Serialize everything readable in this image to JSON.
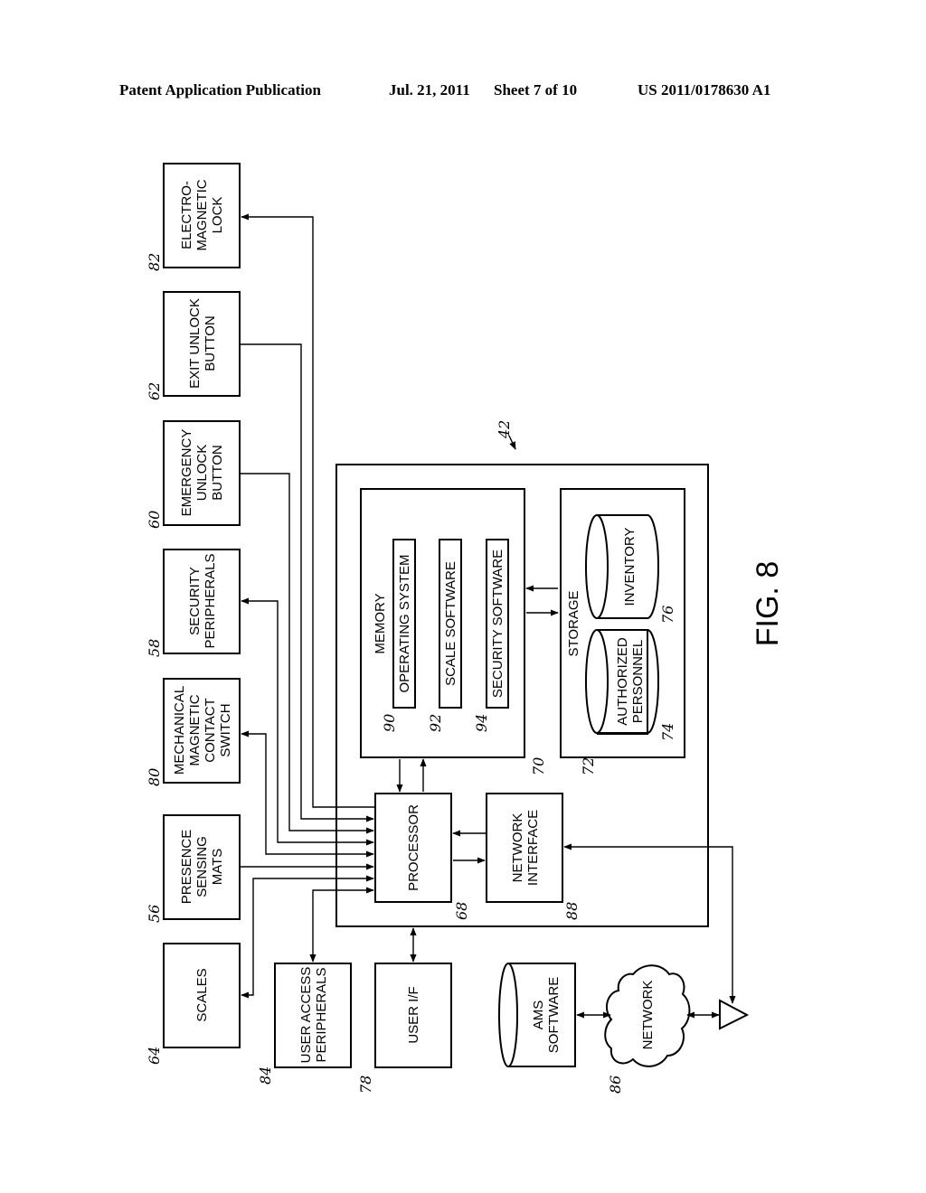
{
  "header": {
    "publication": "Patent Application Publication",
    "date": "Jul. 21, 2011",
    "sheet": "Sheet 7 of 10",
    "number": "US 2011/0178630 A1"
  },
  "figure": {
    "label": "FIG. 8",
    "system": {
      "ref": "42"
    },
    "peripherals": [
      {
        "id": "electromagnetic-lock",
        "ref": "82",
        "lines": [
          "ELECTRO-",
          "MAGNETIC",
          "LOCK"
        ]
      },
      {
        "id": "exit-unlock-button",
        "ref": "62",
        "lines": [
          "EXIT UNLOCK",
          "BUTTON"
        ]
      },
      {
        "id": "emergency-unlock-button",
        "ref": "60",
        "lines": [
          "EMERGENCY",
          "UNLOCK",
          "BUTTON"
        ]
      },
      {
        "id": "security-peripherals",
        "ref": "58",
        "lines": [
          "SECURITY",
          "PERIPHERALS"
        ]
      },
      {
        "id": "mechanical-magnetic-contact-switch",
        "ref": "80",
        "lines": [
          "MECHANICAL",
          "MAGNETIC",
          "CONTACT",
          "SWITCH"
        ]
      },
      {
        "id": "presence-sensing-mats",
        "ref": "56",
        "lines": [
          "PRESENCE",
          "SENSING",
          "MATS"
        ]
      },
      {
        "id": "scales",
        "ref": "64",
        "lines": [
          "SCALES"
        ]
      }
    ],
    "memory": {
      "ref": "70",
      "title": "MEMORY",
      "items": [
        {
          "ref": "90",
          "label": "OPERATING SYSTEM"
        },
        {
          "ref": "92",
          "label": "SCALE SOFTWARE"
        },
        {
          "ref": "94",
          "label": "SECURITY SOFTWARE"
        }
      ]
    },
    "storage": {
      "ref": "72",
      "title": "STORAGE",
      "databases": [
        {
          "ref": "74",
          "lines": [
            "AUTHORIZED",
            "PERSONNEL"
          ]
        },
        {
          "ref": "76",
          "lines": [
            "INVENTORY"
          ]
        }
      ]
    },
    "processor": {
      "ref": "68",
      "label": "PROCESSOR"
    },
    "network_interface": {
      "ref": "88",
      "lines": [
        "NETWORK",
        "INTERFACE"
      ]
    },
    "user_access_peripherals": {
      "ref": "84",
      "lines": [
        "USER ACCESS",
        "PERIPHERALS"
      ]
    },
    "user_if": {
      "ref": "78",
      "label": "USER I/F"
    },
    "ams_software": {
      "lines": [
        "AMS",
        "SOFTWARE"
      ]
    },
    "network": {
      "ref": "86",
      "label": "NETWORK"
    }
  }
}
